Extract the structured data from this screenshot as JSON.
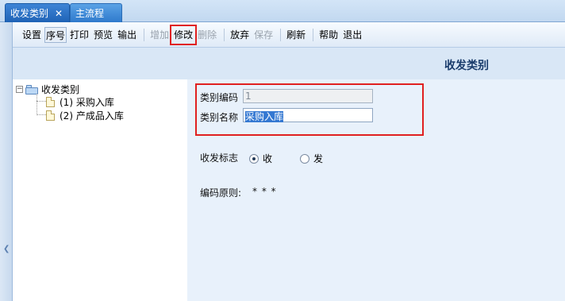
{
  "tabs": [
    {
      "label": "收发类别",
      "close_icon": "✕",
      "active": true
    },
    {
      "label": "主流程",
      "active": false
    }
  ],
  "toolbar": {
    "items": [
      {
        "label": "设置",
        "disabled": false
      },
      {
        "label": "序号",
        "disabled": false
      },
      {
        "label": "打印",
        "disabled": false
      },
      {
        "label": "预览",
        "disabled": false
      },
      {
        "label": "输出",
        "disabled": false
      },
      {
        "label": "增加",
        "disabled": true
      },
      {
        "label": "修改",
        "disabled": false
      },
      {
        "label": "删除",
        "disabled": true
      },
      {
        "label": "放弃",
        "disabled": false
      },
      {
        "label": "保存",
        "disabled": true
      },
      {
        "label": "刷新",
        "disabled": false
      },
      {
        "label": "帮助",
        "disabled": false
      },
      {
        "label": "退出",
        "disabled": false
      }
    ]
  },
  "header": {
    "title": "收发类别"
  },
  "tree": {
    "root_label": "收发类别",
    "expander": "−",
    "nodes": [
      {
        "label": "(1) 采购入库"
      },
      {
        "label": "(2) 产成品入库"
      }
    ]
  },
  "form": {
    "code_label": "类别编码",
    "code_value": "1",
    "name_label": "类别名称",
    "name_value": "采购入库",
    "flag_label": "收发标志",
    "radio_receive": "收",
    "radio_send": "发",
    "rule_label": "编码原则:",
    "rule_value": "* * *"
  },
  "colors": {
    "highlight": "#e02020",
    "tab_active": "#1f63b6",
    "title_text": "#1a3c6c"
  }
}
